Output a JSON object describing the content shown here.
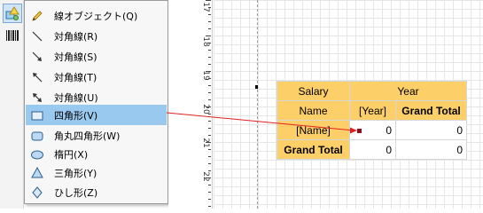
{
  "toolbar": {
    "icons": [
      "shape-tool-icon",
      "barcode-icon"
    ]
  },
  "menu": {
    "items": [
      {
        "label": "線オブジェクト(Q)",
        "icon": "pencil-icon"
      },
      {
        "label": "対角線(R)",
        "icon": "diagonal-line-icon"
      },
      {
        "label": "対角線(S)",
        "icon": "diagonal-arrow-icon"
      },
      {
        "label": "対角線(T)",
        "icon": "diagonal-arrow-start-icon"
      },
      {
        "label": "対角線(U)",
        "icon": "diagonal-double-arrow-icon"
      },
      {
        "label": "四角形(V)",
        "icon": "rectangle-icon"
      },
      {
        "label": "角丸四角形(W)",
        "icon": "rounded-rectangle-icon"
      },
      {
        "label": "楕円(X)",
        "icon": "ellipse-icon"
      },
      {
        "label": "三角形(Y)",
        "icon": "triangle-icon"
      },
      {
        "label": "ひし形(Z)",
        "icon": "diamond-icon"
      }
    ],
    "highlighted_index": 5
  },
  "ruler": {
    "labels": [
      "17",
      "18",
      "19",
      "20",
      "21",
      "22"
    ]
  },
  "crosstab": {
    "r1": {
      "c1": "Salary",
      "c2": "Year"
    },
    "r2": {
      "c1": "Name",
      "c2": "[Year]",
      "c3": "Grand Total"
    },
    "r3": {
      "c1": "[Name]",
      "c2": "0",
      "c3": "0"
    },
    "r4": {
      "c1": "Grand Total",
      "c2": "0",
      "c3": "0"
    }
  },
  "colors": {
    "header": "#fdcf68",
    "highlight": "#99c9ef",
    "connector": "#e02020"
  }
}
